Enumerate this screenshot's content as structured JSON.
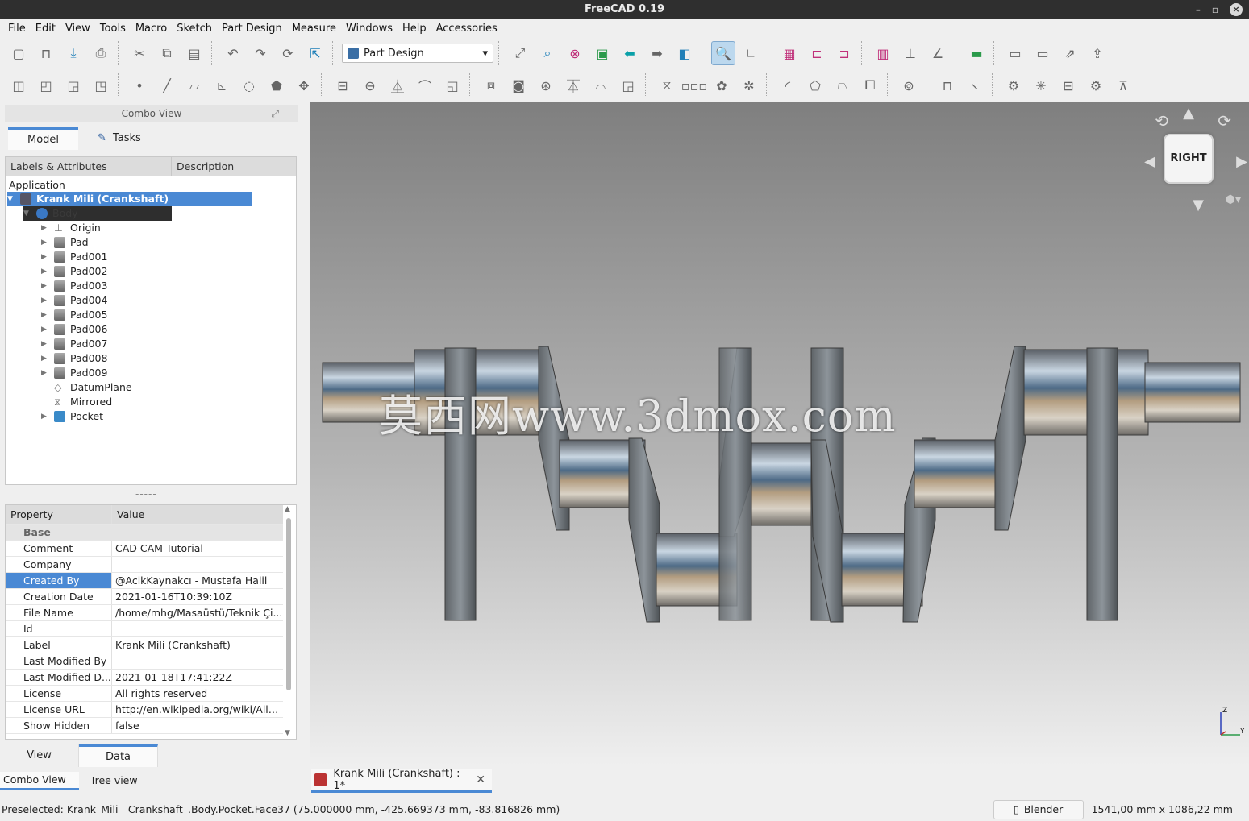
{
  "window": {
    "title": "FreeCAD 0.19"
  },
  "menu": [
    "File",
    "Edit",
    "View",
    "Tools",
    "Macro",
    "Sketch",
    "Part Design",
    "Measure",
    "Windows",
    "Help",
    "Accessories"
  ],
  "toolbar": {
    "workbench": "Part Design"
  },
  "combo_view": {
    "title": "Combo View",
    "tabs": [
      "Model",
      "Tasks"
    ],
    "tree_headers": [
      "Labels & Attributes",
      "Description"
    ],
    "application_label": "Application",
    "document_label": "Krank Mili (Crankshaft)",
    "body_label": "Body",
    "items": [
      "Origin",
      "Pad",
      "Pad001",
      "Pad002",
      "Pad003",
      "Pad004",
      "Pad005",
      "Pad006",
      "Pad007",
      "Pad008",
      "Pad009",
      "DatumPlane",
      "Mirrored",
      "Pocket"
    ]
  },
  "properties": {
    "headers": [
      "Property",
      "Value"
    ],
    "group": "Base",
    "rows": [
      {
        "k": "Comment",
        "v": "CAD CAM Tutorial"
      },
      {
        "k": "Company",
        "v": ""
      },
      {
        "k": "Created By",
        "v": "@AcikKaynakcı - Mustafa Halil"
      },
      {
        "k": "Creation Date",
        "v": "2021-01-16T10:39:10Z"
      },
      {
        "k": "File Name",
        "v": "/home/mhg/Masaüstü/Teknik Çi..."
      },
      {
        "k": "Id",
        "v": ""
      },
      {
        "k": "Label",
        "v": "Krank Mili (Crankshaft)"
      },
      {
        "k": "Last Modified By",
        "v": ""
      },
      {
        "k": "Last Modified D...",
        "v": "2021-01-18T17:41:22Z"
      },
      {
        "k": "License",
        "v": "All rights reserved"
      },
      {
        "k": "License URL",
        "v": "http://en.wikipedia.org/wiki/All_r..."
      },
      {
        "k": "Show Hidden",
        "v": "false"
      }
    ],
    "selected_index": 2
  },
  "view_tabs": [
    "View",
    "Data"
  ],
  "bottom_tabs": [
    "Combo View",
    "Tree view"
  ],
  "viewport": {
    "navcube_face": "RIGHT",
    "watermark": "莫西网www.3dmox.com",
    "axis_z": "Z",
    "axis_y": "Y"
  },
  "document_tab": "Krank Mili (Crankshaft) : 1*",
  "status": {
    "text": "Preselected: Krank_Mili__Crankshaft_.Body.Pocket.Face37 (75.000000 mm, -425.669373 mm, -83.816826 mm)",
    "nav_style": "Blender",
    "dimensions": "1541,00 mm x 1086,22 mm"
  }
}
